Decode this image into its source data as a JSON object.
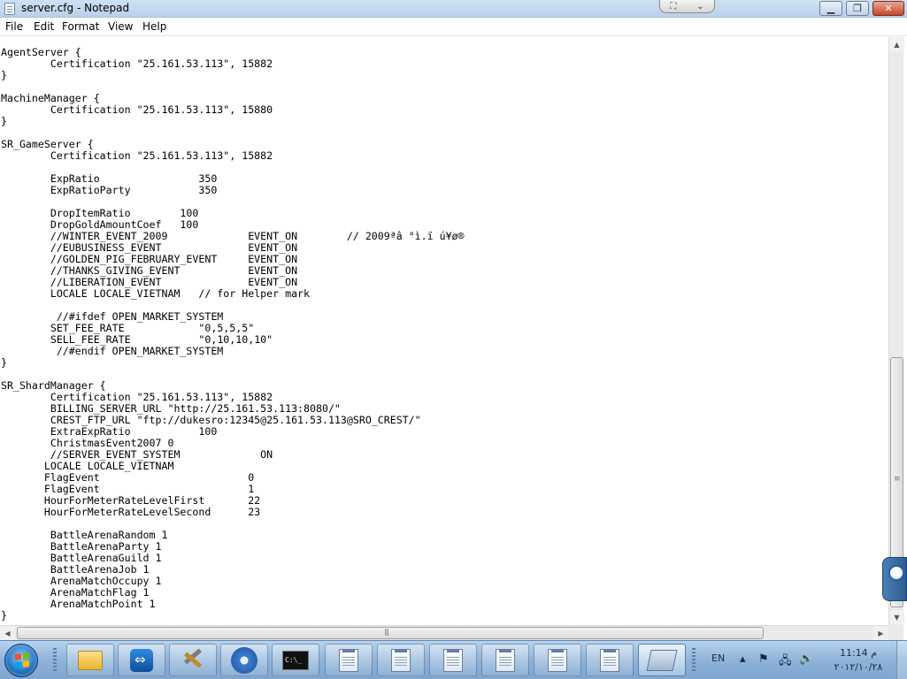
{
  "window": {
    "title": "server.cfg - Notepad"
  },
  "menu": {
    "items": [
      "File",
      "Edit",
      "Format",
      "View",
      "Help"
    ]
  },
  "editor": {
    "content": "AgentServer {\n\tCertification \"25.161.53.113\", 15882\n}\n\nMachineManager {\n\tCertification \"25.161.53.113\", 15880\n}\n\nSR_GameServer {\n\tCertification \"25.161.53.113\", 15882\n\n\tExpRatio\t\t350\n\tExpRatioParty\t\t350\n\n\tDropItemRatio\t     100\n\tDropGoldAmountCoef   100\n\t//WINTER_EVENT_2009\t\tEVENT_ON\t// 2009ªâ °ì.ï ú¥ø®\n\t//EUBUSINESS_EVENT\t\tEVENT_ON\n\t//GOLDEN_PIG_FEBRUARY_EVENT\tEVENT_ON\n\t//THANKS_GIVING_EVENT\t\tEVENT_ON\n\t//LIBERATION_EVENT\t\tEVENT_ON\n\tLOCALE LOCALE_VIETNAM   // for Helper mark\n\n\t //#ifdef OPEN_MARKET_SYSTEM\n\tSET_FEE_RATE\t\t\"0,5,5,5\"\n\tSELL_FEE_RATE\t\t\"0,10,10,10\"\n\t //#endif OPEN_MARKET_SYSTEM\n}\n\nSR_ShardManager {\n\tCertification \"25.161.53.113\", 15882\n\tBILLING_SERVER_URL \"http://25.161.53.113:8080/\"\n\tCREST_FTP_URL \"ftp://dukesro:12345@25.161.53.113@SRO_CREST/\"\n\tExtraExpRatio\t\t100\n\tChristmasEvent2007 0\n\t//SERVER_EVENT_SYSTEM\t\t  ON\n       LOCALE LOCALE_VIETNAM\n       FlagEvent\t\t\t0\n       FlagEvent\t\t\t1\n       HourForMeterRateLevelFirst\t22\n       HourForMeterRateLevelSecond\t23\n\n\tBattleArenaRandom 1\n\tBattleArenaParty 1\n\tBattleArenaGuild 1\n\tBattleArenaJob 1\n\tArenaMatchOccupy 1\n\tArenaMatchFlag 1\n\tArenaMatchPoint 1\n}"
  },
  "taskbar": {
    "cmd_label": "C:\\_"
  },
  "tray": {
    "language": "EN",
    "time": "11:14 م",
    "date": "٢٠١٢/١٠/٢٨"
  },
  "colors": {
    "titlebar": "#b9d1ea",
    "taskbar": "#8fb3d9",
    "close_button": "#c8452b"
  }
}
